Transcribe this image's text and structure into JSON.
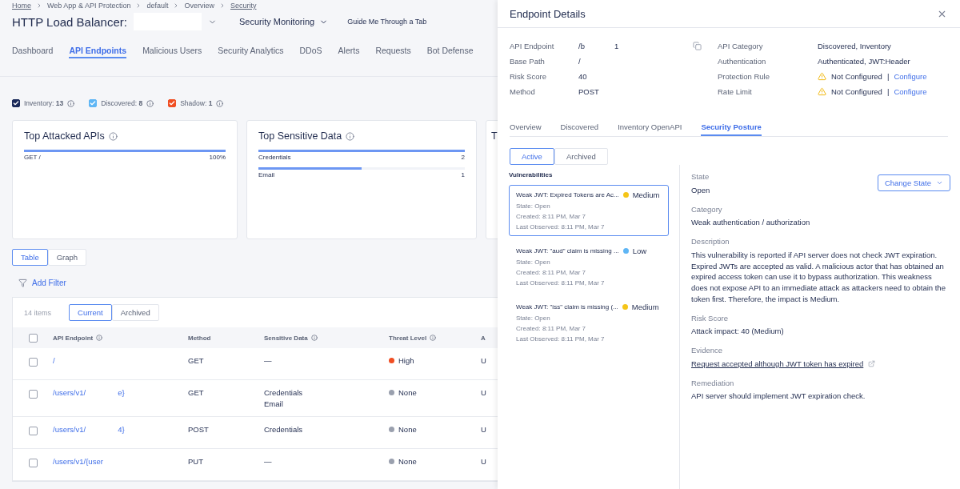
{
  "breadcrumb": [
    {
      "label": "Home",
      "link": true
    },
    {
      "label": "Web App & API Protection",
      "link": false
    },
    {
      "label": "default",
      "link": false
    },
    {
      "label": "Overview",
      "link": false
    },
    {
      "label": "Security",
      "link": true
    }
  ],
  "header": {
    "title": "HTTP Load Balancer:",
    "view": "Security Monitoring",
    "guide": "Guide Me Through a Tab"
  },
  "tabs": [
    {
      "label": "Dashboard",
      "selected": false
    },
    {
      "label": "API Endpoints",
      "selected": true
    },
    {
      "label": "Malicious Users",
      "selected": false
    },
    {
      "label": "Security Analytics",
      "selected": false
    },
    {
      "label": "DDoS",
      "selected": false
    },
    {
      "label": "Alerts",
      "selected": false
    },
    {
      "label": "Requests",
      "selected": false
    },
    {
      "label": "Bot Defense",
      "selected": false
    }
  ],
  "filters": [
    {
      "label": "Inventory:",
      "count": "13",
      "checked": true,
      "color": "#1b2a5a"
    },
    {
      "label": "Discovered:",
      "count": "8",
      "checked": true,
      "color": "#5fb6f5"
    },
    {
      "label": "Shadow:",
      "count": "1",
      "checked": true,
      "color": "#f04e23"
    }
  ],
  "cards": [
    {
      "title": "Top Attacked APIs",
      "rows": [
        {
          "label": "GET /",
          "value": "100%",
          "level": 1
        }
      ]
    },
    {
      "title": "Top Sensitive Data",
      "rows": [
        {
          "label": "Credentials",
          "value": "2",
          "level": 1
        },
        {
          "label": "Email",
          "value": "1",
          "level": 0.5
        }
      ]
    },
    {
      "title": "T"
    }
  ],
  "view_toggle": [
    {
      "label": "Table",
      "selected": true
    },
    {
      "label": "Graph",
      "selected": false
    }
  ],
  "add_filter": "Add Filter",
  "table": {
    "count": "14 items",
    "segments": [
      {
        "label": "Current",
        "selected": true
      },
      {
        "label": "Archived",
        "selected": false
      }
    ],
    "select_all_checked": false,
    "columns": [
      "API Endpoint",
      "Method",
      "Sensitive Data",
      "Threat Level",
      "A"
    ],
    "rows": [
      {
        "endpoint": [
          "/"
        ],
        "method": "GET",
        "sensitive": [
          "—"
        ],
        "threat": "High",
        "color": "#f04e23",
        "column_5": "U",
        "checked": false
      },
      {
        "endpoint": [
          "/users/v1/",
          "e}"
        ],
        "method": "GET",
        "sensitive": [
          "Credentials",
          "Email"
        ],
        "threat": "None",
        "color": "#9aa0ae",
        "column_5": "U",
        "checked": false
      },
      {
        "endpoint": [
          "/users/v1/",
          "4}"
        ],
        "method": "POST",
        "sensitive": [
          "Credentials"
        ],
        "threat": "None",
        "color": "#9aa0ae",
        "column_5": "U",
        "checked": false
      },
      {
        "endpoint": [
          "/users/v1/{user"
        ],
        "method": "PUT",
        "sensitive": [
          "—"
        ],
        "threat": "None",
        "color": "#9aa0ae",
        "column_5": "U",
        "checked": false
      }
    ]
  },
  "drawer": {
    "title": "Endpoint Details",
    "left_fields": [
      {
        "label": "API Endpoint",
        "value": [
          "/b",
          "1"
        ]
      },
      {
        "label": "Base Path",
        "value": [
          "/"
        ]
      },
      {
        "label": "Risk Score",
        "value": [
          "40"
        ]
      },
      {
        "label": "Method",
        "value": [
          "POST"
        ]
      }
    ],
    "right_fields": [
      {
        "label": "API Category",
        "value": "Discovered, Inventory",
        "kind": "text"
      },
      {
        "label": "Authentication",
        "value": "Authenticated, JWT:Header",
        "kind": "text"
      },
      {
        "label": "Protection Rule",
        "value": "Not Configured",
        "separator": "|",
        "link": "Configure",
        "kind": "warning"
      },
      {
        "label": "Rate Limit",
        "value": "Not Configured",
        "separator": "|",
        "link": "Configure",
        "kind": "warning"
      }
    ],
    "tabs": [
      {
        "label": "Overview",
        "selected": false
      },
      {
        "label": "Discovered",
        "selected": false
      },
      {
        "label": "Inventory OpenAPI",
        "selected": false
      },
      {
        "label": "Security Posture",
        "selected": true
      }
    ],
    "segments": [
      {
        "label": "Active",
        "selected": true
      },
      {
        "label": "Archived",
        "selected": false
      }
    ],
    "vulnerabilities_heading": "Vulnerabilities",
    "vulnerabilities": [
      {
        "title": "Weak JWT: Expired Tokens are Ac...",
        "severity": "Medium",
        "color": "#f5c518",
        "state": "State: Open",
        "created": "Created: 8:11 PM, Mar 7",
        "observed": "Last Observed: 8:11 PM, Mar 7",
        "selected": true
      },
      {
        "title": "Weak JWT: \"aud\" claim is missing ...",
        "severity": "Low",
        "color": "#5fb6f5",
        "state": "State: Open",
        "created": "Created: 8:11 PM, Mar 7",
        "observed": "Last Observed: 8:11 PM, Mar 7",
        "selected": false
      },
      {
        "title": "Weak JWT: \"iss\" claim is missing (...",
        "severity": "Medium",
        "color": "#f5c518",
        "state": "State: Open",
        "created": "Created: 8:11 PM, Mar 7",
        "observed": "Last Observed: 8:11 PM, Mar 7",
        "selected": false
      }
    ],
    "change_state": "Change State",
    "details": [
      {
        "label": "State",
        "value": "Open",
        "kind": "text"
      },
      {
        "label": "Category",
        "value": "Weak authentication / authorization",
        "kind": "text"
      },
      {
        "label": "Description",
        "value": "This vulnerability is reported if API server does not check JWT expiration. Expired JWTs are accepted as valid. A malicious actor that has obtained an expired access token can use it to bypass authorization. This weakness does not expose API to an immediate attack as attackers need to obtain the token first. Therefore, the impact is Medium.",
        "kind": "text"
      },
      {
        "label": "Risk Score",
        "value": "Attack impact: 40 (Medium)",
        "kind": "text"
      },
      {
        "label": "Evidence",
        "value": "Request accepted although JWT token has expired",
        "kind": "link"
      },
      {
        "label": "Remediation",
        "value": "API server should implement JWT expiration check.",
        "kind": "text"
      }
    ]
  }
}
